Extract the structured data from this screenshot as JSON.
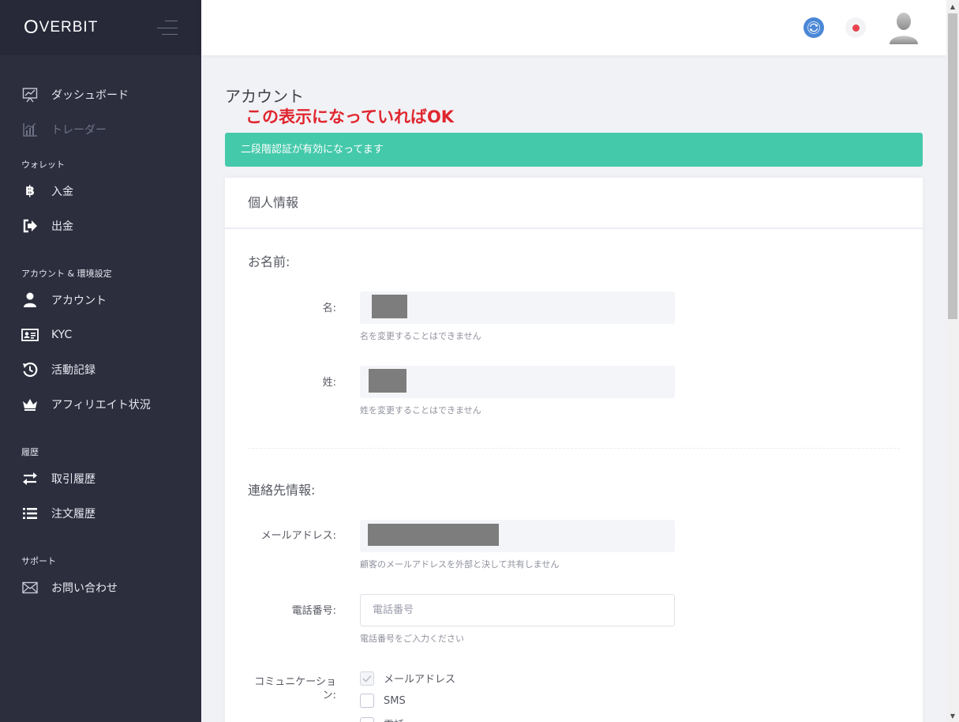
{
  "brand": {
    "logo_first": "O",
    "logo_rest": "VERBIT"
  },
  "sidebar": {
    "items_top": [
      {
        "label": "ダッシュボード",
        "icon": "chart-line-icon"
      },
      {
        "label": "トレーダー",
        "icon": "bar-chart-icon",
        "disabled": true
      }
    ],
    "section_wallet": "ウォレット",
    "wallet_items": [
      {
        "label": "入金",
        "icon": "bitcoin-icon"
      },
      {
        "label": "出金",
        "icon": "sign-out-icon"
      }
    ],
    "section_account": "アカウント & 環境設定",
    "account_items": [
      {
        "label": "アカウント",
        "icon": "user-icon"
      },
      {
        "label": "KYC",
        "icon": "id-card-icon"
      },
      {
        "label": "活動記録",
        "icon": "history-icon"
      },
      {
        "label": "アフィリエイト状況",
        "icon": "crown-icon"
      }
    ],
    "section_history": "履歴",
    "history_items": [
      {
        "label": "取引履歴",
        "icon": "exchange-icon"
      },
      {
        "label": "注文履歴",
        "icon": "list-icon"
      }
    ],
    "section_support": "サポート",
    "support_items": [
      {
        "label": "お問い合わせ",
        "icon": "envelope-icon"
      }
    ]
  },
  "topbar": {
    "icons": [
      "refresh-icon",
      "status-dot-icon",
      "avatar-icon"
    ],
    "status_color": "#e8434f",
    "refresh_color": "#4a87d6"
  },
  "main": {
    "page_title": "アカウント",
    "annotation": "この表示になっていればOK",
    "alert": "二段階認証が有効になってます",
    "alert_color": "#45c9ab",
    "card_title": "個人情報",
    "name_section": "お名前:",
    "first_name_label": "名:",
    "first_name_help": "名を変更することはできません",
    "last_name_label": "姓:",
    "last_name_help": "姓を変更することはできません",
    "contact_section": "連絡先情報:",
    "email_label": "メールアドレス:",
    "email_help": "顧客のメールアドレスを外部と決して共有しません",
    "phone_label": "電話番号:",
    "phone_placeholder": "電話番号",
    "phone_value": "",
    "phone_help": "電話番号をご入力ください",
    "communication_label": "コミュニケーション:",
    "communication_options": [
      {
        "label": "メールアドレス",
        "checked": true
      },
      {
        "label": "SMS",
        "checked": false
      },
      {
        "label": "電話",
        "checked": false
      }
    ]
  }
}
